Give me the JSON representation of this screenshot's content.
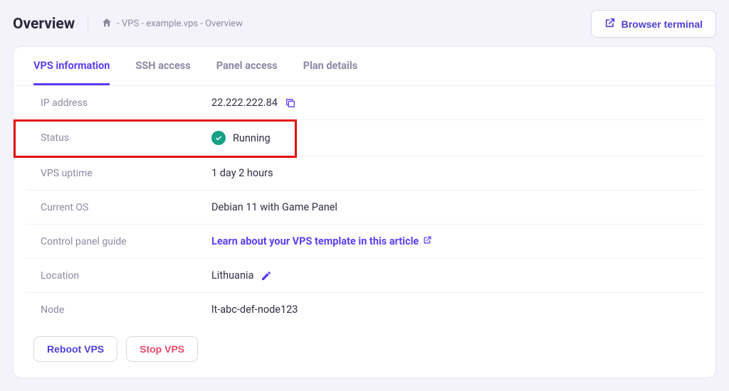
{
  "header": {
    "title": "Overview",
    "breadcrumb": "- VPS - example.vps - Overview",
    "terminal_btn": "Browser terminal"
  },
  "tabs": [
    {
      "label": "VPS information",
      "active": true
    },
    {
      "label": "SSH access",
      "active": false
    },
    {
      "label": "Panel access",
      "active": false
    },
    {
      "label": "Plan details",
      "active": false
    }
  ],
  "info": {
    "ip_label": "IP address",
    "ip_value": "22.222.222.84",
    "status_label": "Status",
    "status_value": "Running",
    "uptime_label": "VPS uptime",
    "uptime_value": "1 day 2 hours",
    "os_label": "Current OS",
    "os_value": "Debian 11 with Game Panel",
    "guide_label": "Control panel guide",
    "guide_link": "Learn about your VPS template in this article",
    "location_label": "Location",
    "location_value": "Lithuania",
    "node_label": "Node",
    "node_value": "lt-abc-def-node123"
  },
  "actions": {
    "reboot": "Reboot VPS",
    "stop": "Stop VPS"
  }
}
